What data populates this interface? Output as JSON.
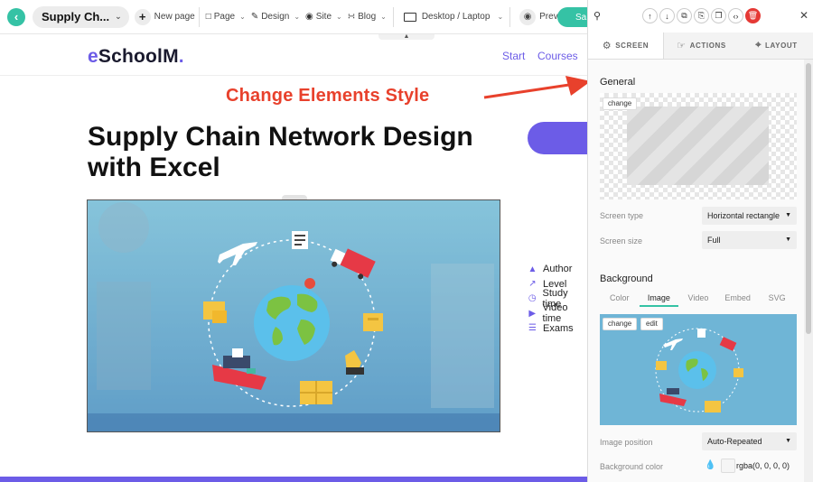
{
  "toolbar": {
    "page_title": "Supply Ch...",
    "new_page_label": "New page",
    "menu": [
      "Page",
      "Design",
      "Site",
      "Blog"
    ],
    "device_label": "Desktop / Laptop",
    "preview_label": "Preview",
    "save_label": "Sa"
  },
  "site": {
    "logo_prefix": "e",
    "logo_main": "SchoolM",
    "logo_suffix": ".",
    "nav": [
      "Start",
      "Courses"
    ],
    "course_title": "Supply Chain Network Design with Excel",
    "meta": [
      "Author",
      "Level",
      "Study time",
      "Video time",
      "Exams"
    ]
  },
  "annotation": {
    "text": "Change Elements Style",
    "color": "#e8412c"
  },
  "panel": {
    "tabs": [
      "SCREEN",
      "ACTIONS",
      "LAYOUT"
    ],
    "general_title": "General",
    "change_label": "change",
    "edit_label": "edit",
    "screen_type_label": "Screen type",
    "screen_type_value": "Horizontal rectangle",
    "screen_size_label": "Screen size",
    "screen_size_value": "Full",
    "background_title": "Background",
    "bg_tabs": [
      "Color",
      "Image",
      "Video",
      "Embed",
      "SVG"
    ],
    "bg_active_tab": "Image",
    "image_position_label": "Image position",
    "image_position_value": "Auto-Repeated",
    "bg_color_label": "Background color",
    "bg_color_value": "rgba(0, 0, 0, 0)"
  },
  "colors": {
    "accent": "#35c2a5",
    "brand": "#6c5ce7",
    "delete": "#e53935"
  }
}
